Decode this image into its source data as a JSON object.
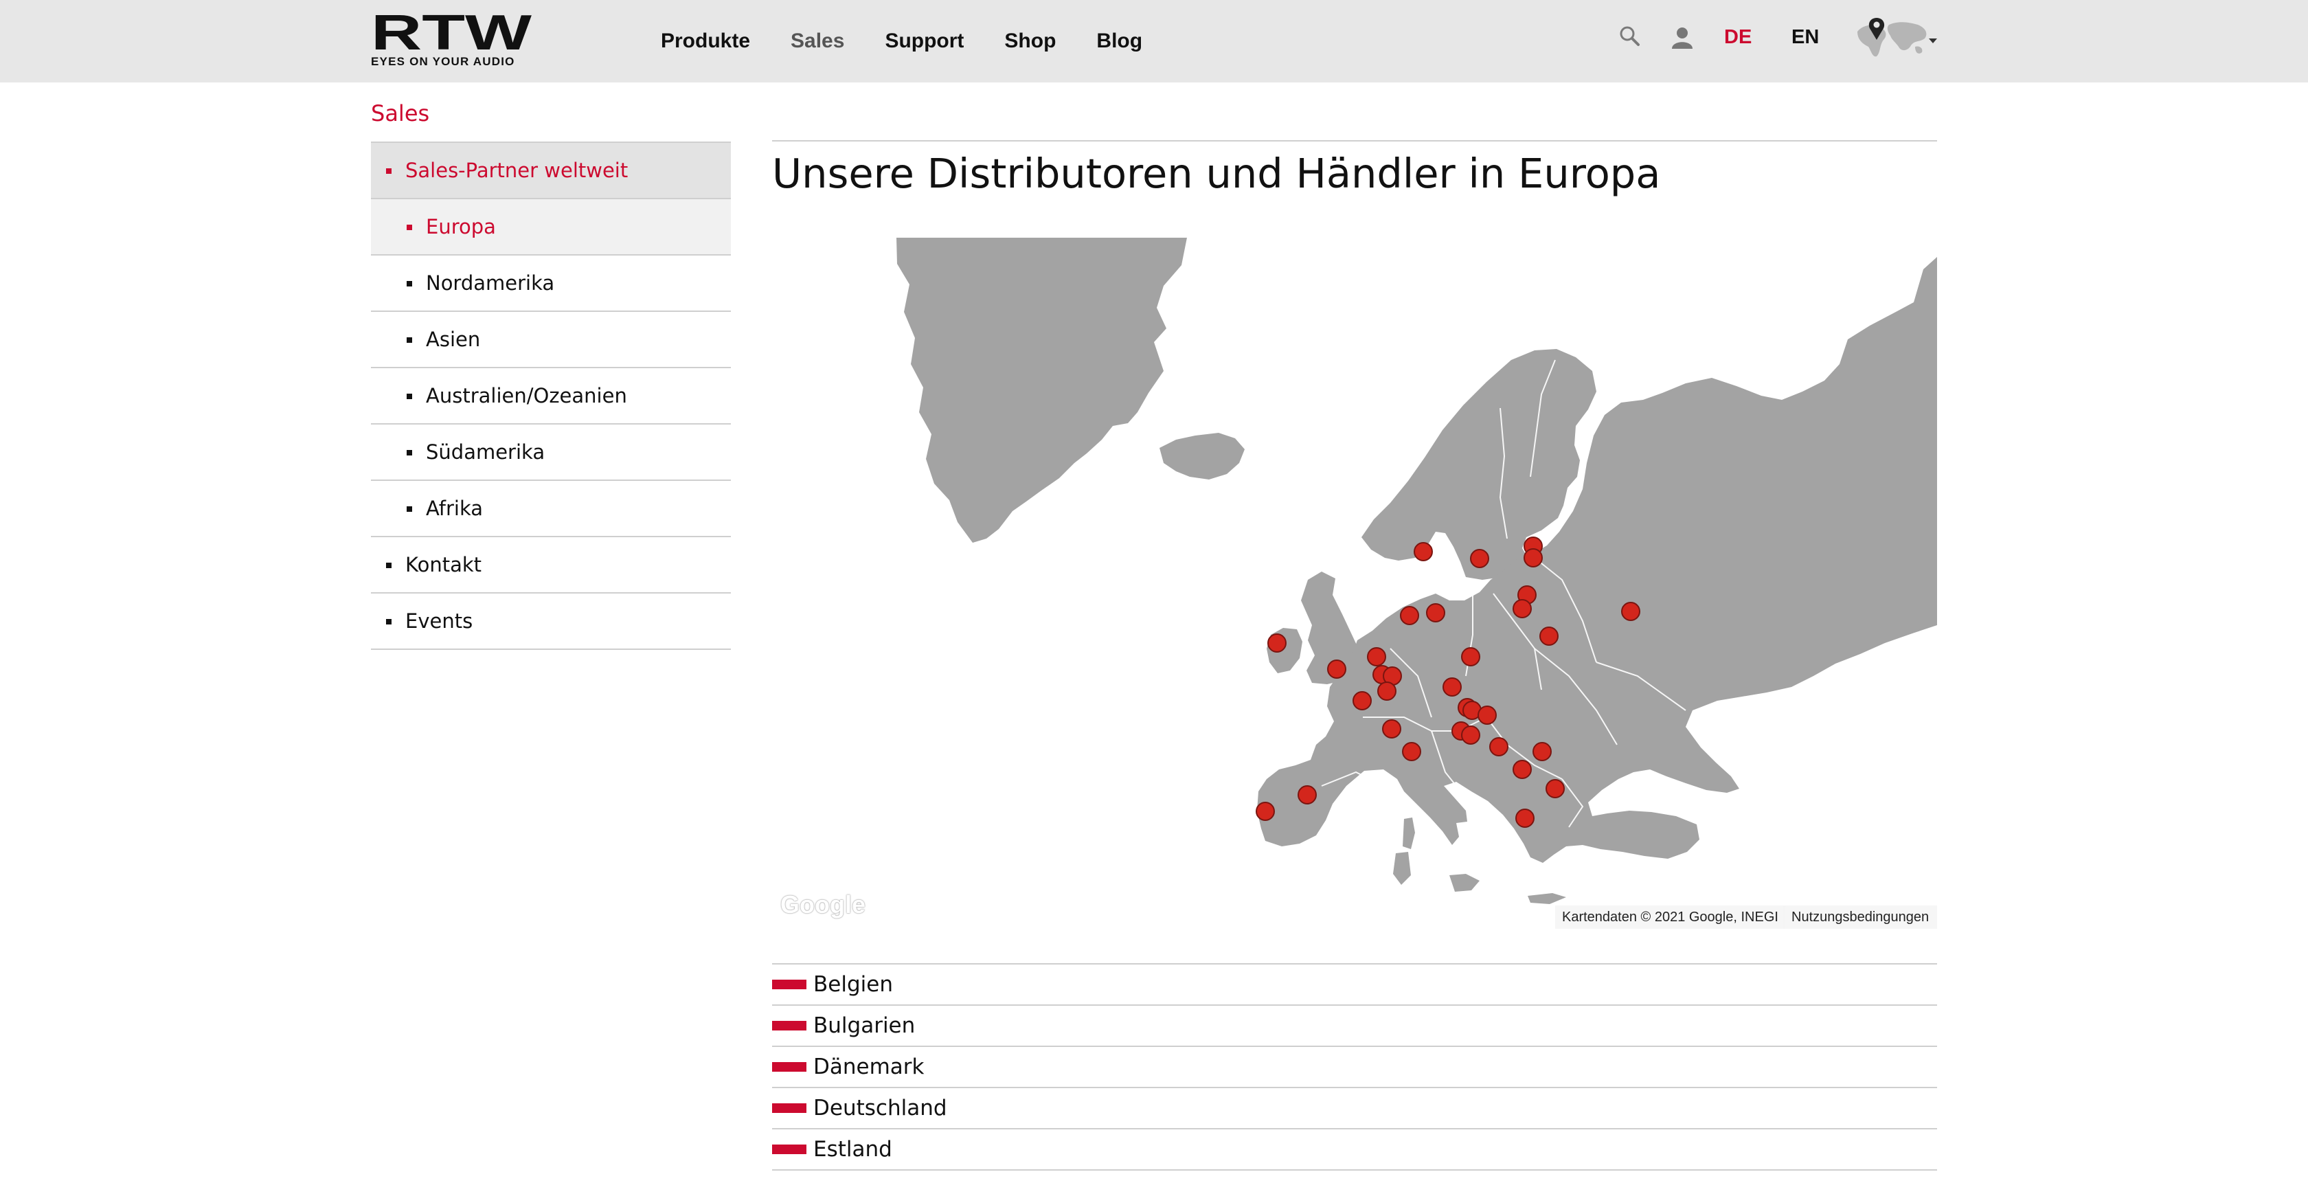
{
  "header": {
    "logo_text": "RTW",
    "tagline": "EYES ON YOUR AUDIO",
    "nav": [
      {
        "label": "Produkte",
        "active": false
      },
      {
        "label": "Sales",
        "active": true
      },
      {
        "label": "Support",
        "active": false
      },
      {
        "label": "Shop",
        "active": false
      },
      {
        "label": "Blog",
        "active": false
      }
    ],
    "lang_de": "DE",
    "lang_en": "EN",
    "icons": [
      "search-icon",
      "user-icon",
      "world-map-pin-icon",
      "caret-down-icon"
    ]
  },
  "sidebar": {
    "section_label": "Sales",
    "items": [
      {
        "label": "Sales-Partner weltweit",
        "level": 1,
        "state": "parent-active"
      },
      {
        "label": "Europa",
        "level": 2,
        "state": "current"
      },
      {
        "label": "Nordamerika",
        "level": 2,
        "state": ""
      },
      {
        "label": "Asien",
        "level": 2,
        "state": ""
      },
      {
        "label": "Australien/Ozeanien",
        "level": 2,
        "state": ""
      },
      {
        "label": "Südamerika",
        "level": 2,
        "state": ""
      },
      {
        "label": "Afrika",
        "level": 2,
        "state": ""
      },
      {
        "label": "Kontakt",
        "level": 1,
        "state": ""
      },
      {
        "label": "Events",
        "level": 1,
        "state": ""
      }
    ]
  },
  "main": {
    "title": "Unsere Distributoren und Händler in Europa",
    "map": {
      "google_logo": "Google",
      "copyright": "Kartendaten © 2021 Google, INEGI",
      "terms": "Nutzungsbedingungen",
      "marker_color": "#d3261c",
      "land_color": "#a3a3a3"
    },
    "countries": [
      "Belgien",
      "Bulgarien",
      "Dänemark",
      "Deutschland",
      "Estland"
    ]
  },
  "colors": {
    "accent": "#cc0a2f",
    "header_bg": "#e7e7e7"
  }
}
